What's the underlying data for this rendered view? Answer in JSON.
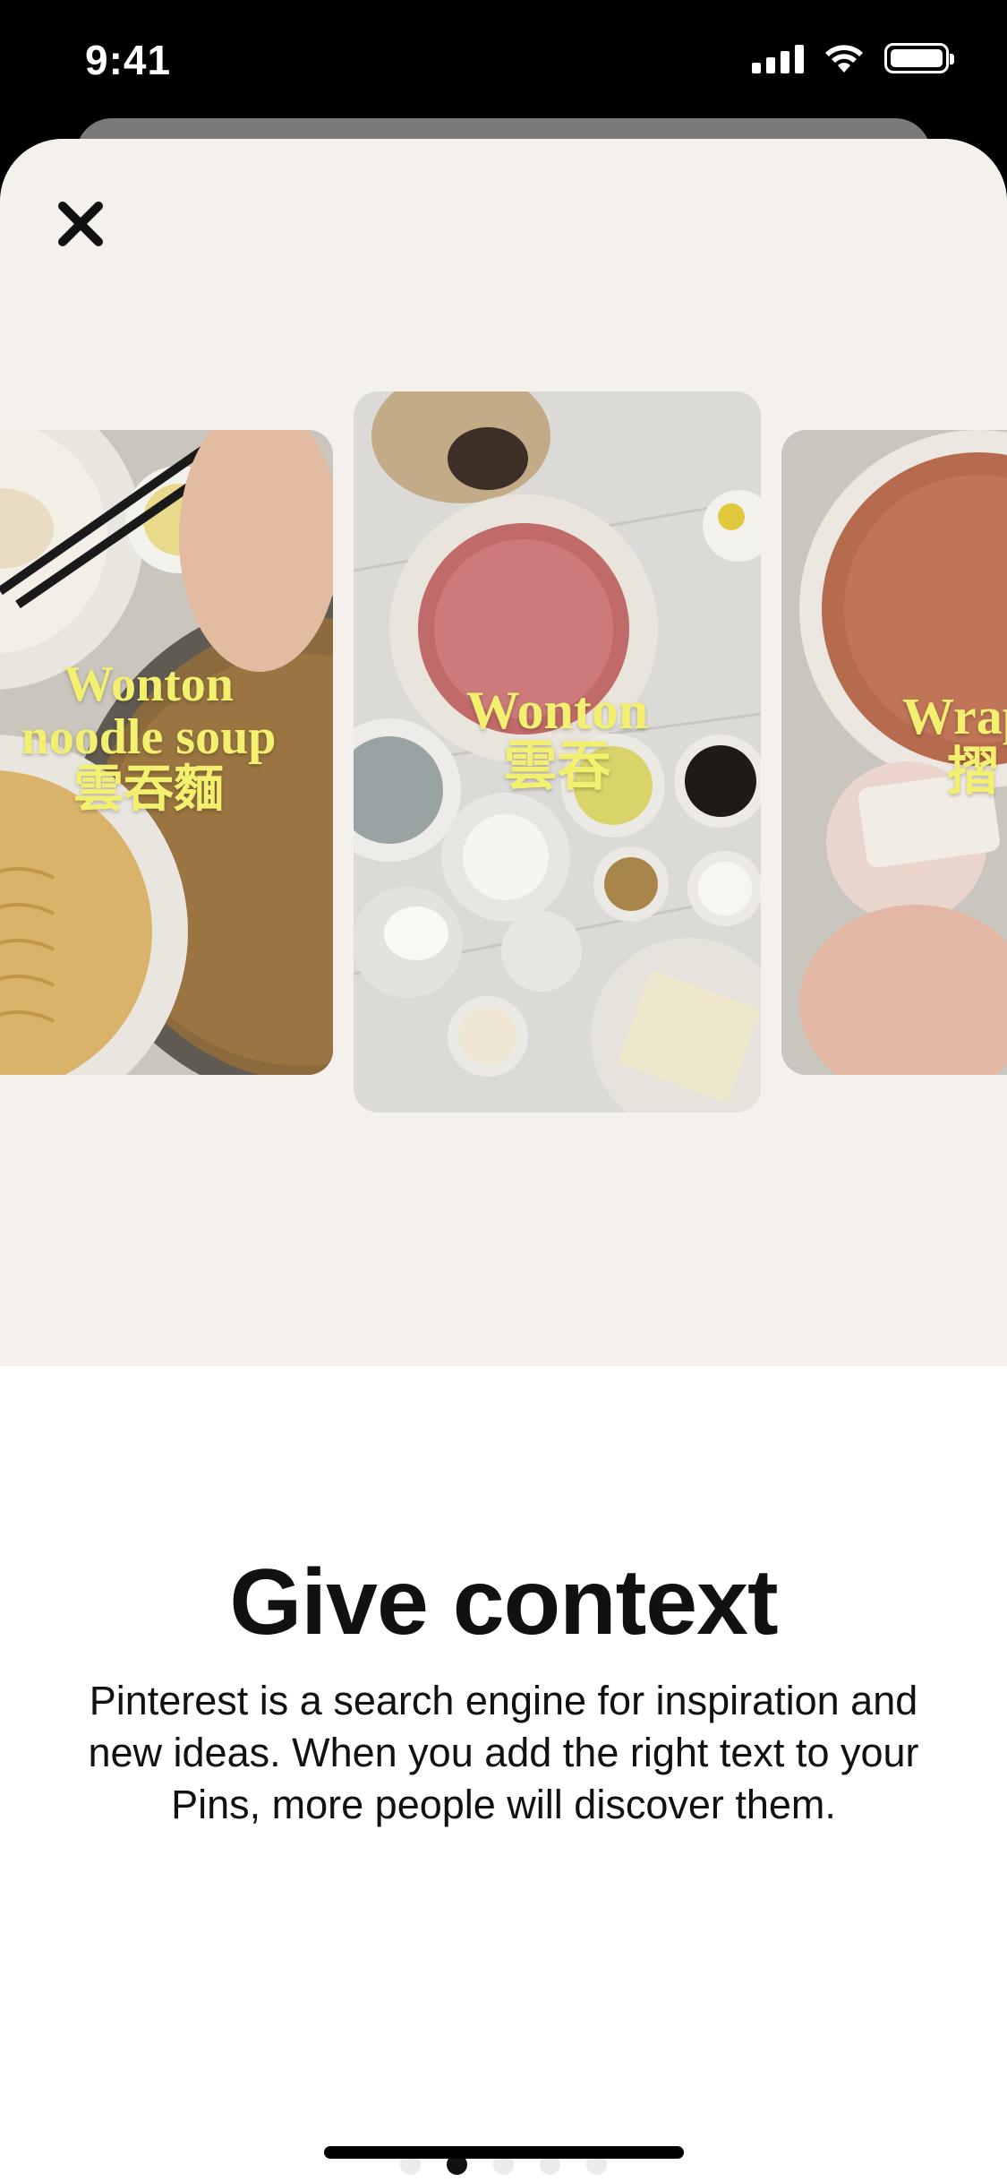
{
  "status_bar": {
    "time": "9:41"
  },
  "pins": [
    {
      "lines": [
        "Wonton",
        "noodle soup",
        "雲吞麵"
      ]
    },
    {
      "lines": [
        "Wonton",
        "雲吞"
      ]
    },
    {
      "lines": [
        "Wrap",
        "摺"
      ]
    }
  ],
  "onboarding": {
    "title": "Give context",
    "description": "Pinterest is a search engine for inspiration and new ideas. When you add the right text to your Pins, more people will discover them.",
    "page_count": 5,
    "active_page": 2
  },
  "colors": {
    "hero_background": "#f4f1ec",
    "pin_text": "#f3ef6f",
    "dot_active": "#111111",
    "dot_inactive": "#ebebeb"
  },
  "icons": {
    "close": "close-icon",
    "signal": "cellular-signal-icon",
    "wifi": "wifi-icon",
    "battery": "battery-icon"
  }
}
